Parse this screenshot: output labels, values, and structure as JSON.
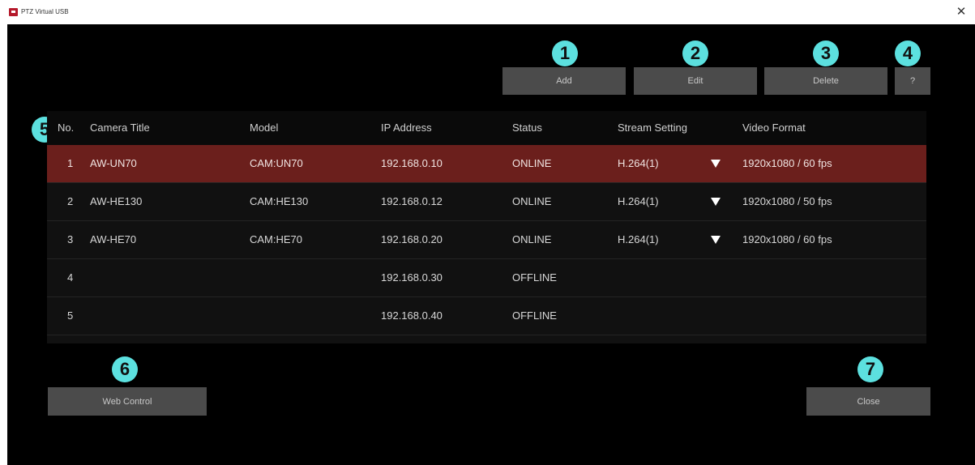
{
  "window": {
    "title": "PTZ Virtual USB"
  },
  "toolbar": {
    "add_label": "Add",
    "edit_label": "Edit",
    "delete_label": "Delete",
    "help_label": "?"
  },
  "badges": [
    "1",
    "2",
    "3",
    "4",
    "5",
    "6",
    "7"
  ],
  "table": {
    "columns": [
      "No.",
      "Camera Title",
      "Model",
      "IP Address",
      "Status",
      "Stream Setting",
      "Video Format"
    ],
    "rows": [
      {
        "no": "1",
        "title": "AW-UN70",
        "model": "CAM:UN70",
        "ip": "192.168.0.10",
        "status": "ONLINE",
        "stream": "H.264(1)",
        "format": "1920x1080 / 60 fps",
        "selected": true
      },
      {
        "no": "2",
        "title": "AW-HE130",
        "model": "CAM:HE130",
        "ip": "192.168.0.12",
        "status": "ONLINE",
        "stream": "H.264(1)",
        "format": "1920x1080 / 50 fps"
      },
      {
        "no": "3",
        "title": "AW-HE70",
        "model": "CAM:HE70",
        "ip": "192.168.0.20",
        "status": "ONLINE",
        "stream": "H.264(1)",
        "format": "1920x1080 / 60 fps"
      },
      {
        "no": "4",
        "title": "",
        "model": "",
        "ip": "192.168.0.30",
        "status": "OFFLINE",
        "stream": "",
        "format": ""
      },
      {
        "no": "5",
        "title": "",
        "model": "",
        "ip": "192.168.0.40",
        "status": "OFFLINE",
        "stream": "",
        "format": ""
      }
    ]
  },
  "footer": {
    "web_control_label": "Web Control",
    "close_label": "Close"
  },
  "colors": {
    "background": "#000000",
    "selected_row": "#6b1f1c",
    "button": "#4b4b4b",
    "badge": "#5ce0df"
  }
}
